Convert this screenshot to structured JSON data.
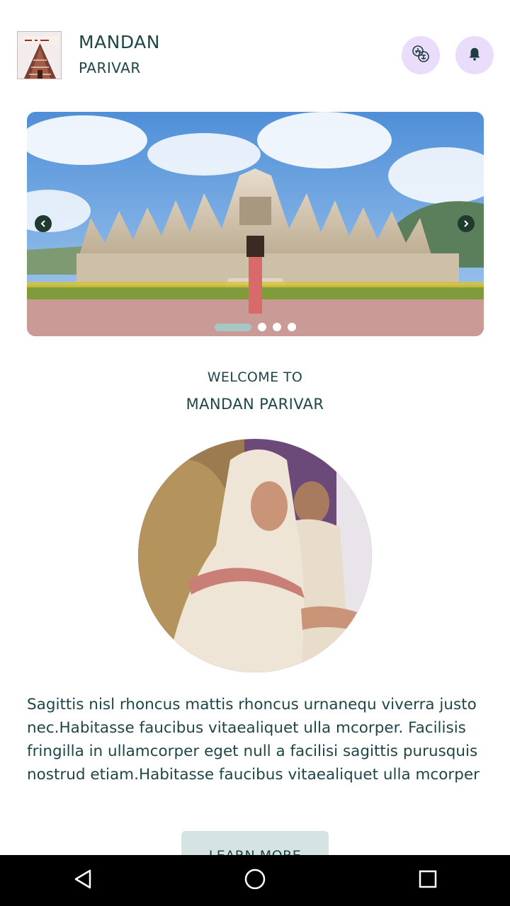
{
  "header": {
    "logo_name": "mandan-parivar-logo",
    "title": "MANDAN",
    "subtitle": "PARIVAR",
    "language_icon": "language-translate-icon",
    "notification_icon": "bell-icon"
  },
  "carousel": {
    "prev_icon": "chevron-left-icon",
    "next_icon": "chevron-right-icon",
    "slide_count": 4,
    "active_slide": 1
  },
  "welcome": {
    "label": "WELCOME TO",
    "name": "MANDAN PARIVAR"
  },
  "intro": {
    "text": "Sagittis nisl rhoncus mattis rhoncus urnanequ viverra justo nec.Habitasse faucibus vitaealiquet ulla mcorper. Facilisis fringilla in ullamcorper eget null a facilisi sagittis purusquis nostrud etiam.Habitasse faucibus vitaealiquet ulla mcorper"
  },
  "cta": {
    "label": "LEARN MORE"
  },
  "system_nav": {
    "back_icon": "back-triangle-icon",
    "home_icon": "home-circle-icon",
    "recent_icon": "recent-apps-square-icon"
  },
  "colors": {
    "text_primary": "#1e4646",
    "icon_button_bg": "#eadcfb",
    "active_dot": "#a7c7c5",
    "cta_bg": "#d6e3e3",
    "nav_bar": "#000000"
  }
}
